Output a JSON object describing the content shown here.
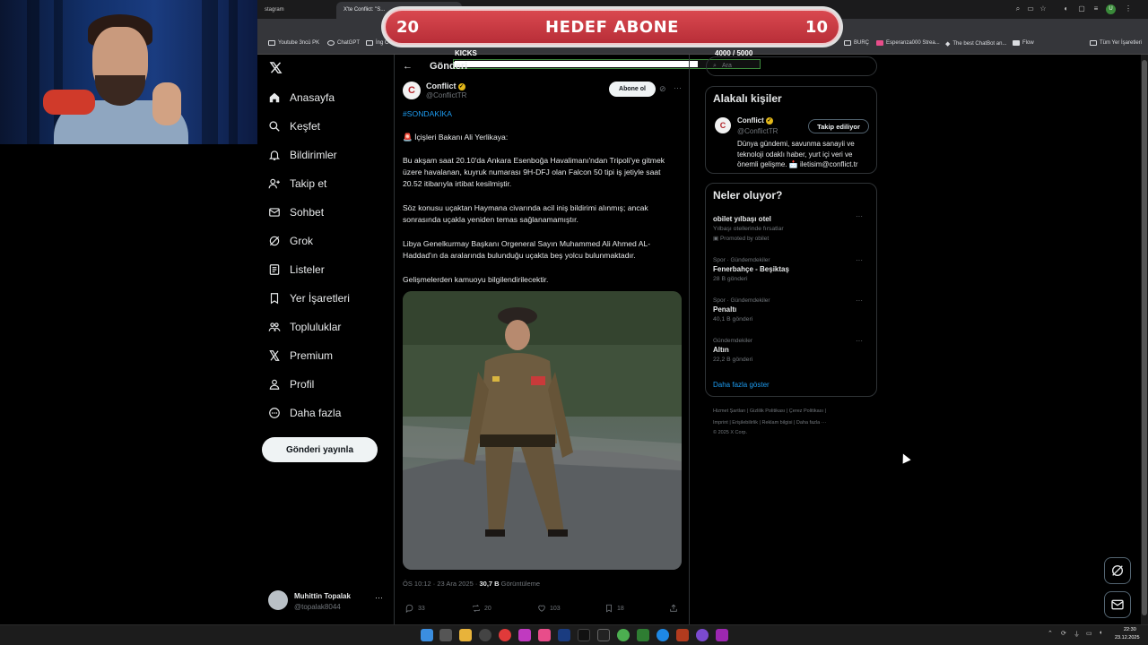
{
  "browser": {
    "tabs": [
      {
        "label": "stagram"
      },
      {
        "label": "X'te Conflict: \"S..."
      }
    ],
    "bookmarks": [
      {
        "label": "Youtube 3ncü PK"
      },
      {
        "label": "ChatGPT"
      },
      {
        "label": "İng C"
      },
      {
        "label": "BURÇ"
      },
      {
        "label": "Esperanza000 Strea..."
      },
      {
        "label": "The best ChatBot an..."
      },
      {
        "label": "Flow"
      },
      {
        "label": "Tüm Yer İşaretleri"
      }
    ],
    "profile_initial": "U"
  },
  "overlay": {
    "left_value": "20",
    "title": "HEDEF ABONE",
    "right_value": "10",
    "kicks_label": "KICKS",
    "kicks_count": "4000  / 5000",
    "kicks_progress": 0.8
  },
  "nav": {
    "items": [
      {
        "label": "Anasayfa"
      },
      {
        "label": "Keşfet"
      },
      {
        "label": "Bildirimler"
      },
      {
        "label": "Takip et"
      },
      {
        "label": "Sohbet"
      },
      {
        "label": "Grok"
      },
      {
        "label": "Listeler"
      },
      {
        "label": "Yer İşaretleri"
      },
      {
        "label": "Topluluklar"
      },
      {
        "label": "Premium"
      },
      {
        "label": "Profil"
      },
      {
        "label": "Daha fazla"
      }
    ],
    "post_button": "Gönderi yayınla",
    "profile": {
      "name": "Muhittin Topalak",
      "handle": "@topalak8044",
      "more": "···"
    }
  },
  "main": {
    "title": "Gönderi",
    "tweet": {
      "avatar_letter": "C",
      "author": "Conflict",
      "handle": "@ConflictTR",
      "follow_label": "Abone ol",
      "hashtag": "#SONDAKİKA",
      "line1": "🚨 İçişleri Bakanı Ali Yerlikaya:",
      "para1": "Bu akşam saat 20.10'da Ankara Esenboğa Havalimanı'ndan Tripoli'ye gitmek üzere havalanan, kuyruk numarası 9H-DFJ olan Falcon 50 tipi iş jetiyle saat 20.52 itibarıyla irtibat kesilmiştir.",
      "para2": "Söz konusu uçaktan Haymana civarında acil iniş bildirimi alınmış; ancak sonrasında uçakla yeniden temas sağlanamamıştır.",
      "para3": "Libya Genelkurmay Başkanı Orgeneral Sayın Muhammed Ali Ahmed AL-Haddad'ın da aralarında bulunduğu uçakta beş yolcu bulunmaktadır.",
      "para4": "Gelişmelerden kamuoyu bilgilendirilecektir.",
      "timestamp": "ÖS 10:12 · 23 Ara 2025 · ",
      "views_count": "30,7 B",
      "views_label": " Görüntüleme",
      "actions": {
        "replies": "33",
        "reposts": "20",
        "likes": "103",
        "bookmarks": "18"
      }
    }
  },
  "right": {
    "search_placeholder": "Ara",
    "related": {
      "title": "Alakalı kişiler",
      "avatar_letter": "C",
      "name": "Conflict",
      "handle": "@ConflictTR",
      "follow_label": "Takip ediliyor",
      "bio": "Dünya gündemi, savunma sanayii ve teknoloji odaklı haber, yurt içi veri ve önemli gelişme. 📩 iletisim@conflict.tr"
    },
    "trends": {
      "title": "Neler oluyor?",
      "items": [
        {
          "category": "",
          "name": "obilet yılbaşı otel",
          "count": "Yılbaşı otellerinde fırsatlar",
          "promo": "Promoted by obilet"
        },
        {
          "category": "Spor · Gündemdekiler",
          "name": "Fenerbahçe - Beşiktaş",
          "count": "28 B gönderi"
        },
        {
          "category": "Spor · Gündemdekiler",
          "name": "Penaltı",
          "count": "40,1 B gönderi"
        },
        {
          "category": "Gündemdekiler",
          "name": "Altın",
          "count": "22,2 B gönderi"
        }
      ],
      "show_more": "Daha fazla göster"
    },
    "footer": {
      "line1": "Hizmet Şartları  |  Gizlilik Politikası  |  Çerez Politikası  |",
      "line2": "Imprint  |  Erişilebilirlik  |  Reklam bilgisi  |  Daha fazla ···",
      "line3": "© 2025 X Corp."
    }
  },
  "taskbar": {
    "time": "22:30",
    "date": "23.12.2025"
  }
}
